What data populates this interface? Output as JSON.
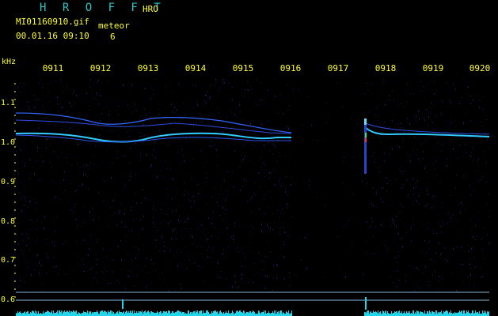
{
  "header": {
    "title": "H R O F F T",
    "mode": "HRO",
    "filename": "MI01160910.gif",
    "datetime": "00.01.16 09:10",
    "detection_label": "meteor",
    "detection_count": "6"
  },
  "axes": {
    "unit": "kHz",
    "time_labels": [
      "0911",
      "0912",
      "0913",
      "0914",
      "0915",
      "0916",
      "0917",
      "0918",
      "0919",
      "0920"
    ],
    "freq_labels": [
      "1.1",
      "1.0",
      "0.9",
      "0.8",
      "0.7",
      "0.6"
    ]
  },
  "colors": {
    "text": "#ffff33",
    "title": "#2ec4c4",
    "signal": "#33ccff",
    "echo": "#4466ff",
    "noise_bar": "#22d4e8",
    "background": "#000000"
  },
  "icons": [
    "meteor-echo-spike"
  ]
}
